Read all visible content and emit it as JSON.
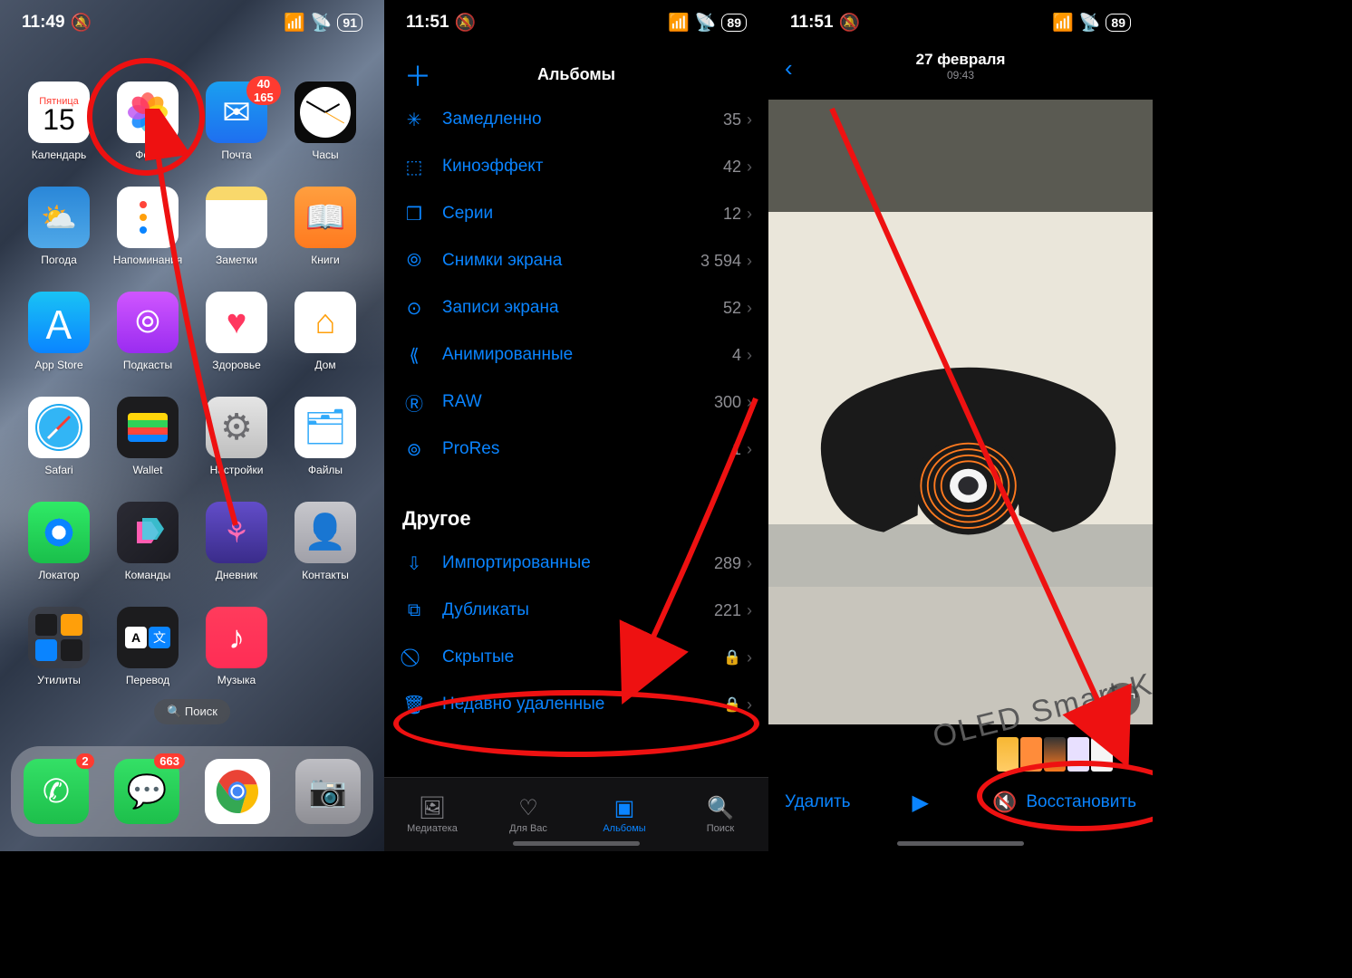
{
  "phone1": {
    "status": {
      "time": "11:49",
      "battery": "91"
    },
    "apps": [
      {
        "id": "calendar",
        "label": "Календарь",
        "day": "Пятница",
        "num": "15"
      },
      {
        "id": "photos",
        "label": "Фото"
      },
      {
        "id": "mail",
        "label": "Почта",
        "badge": "40 165"
      },
      {
        "id": "clock",
        "label": "Часы"
      },
      {
        "id": "weather",
        "label": "Погода"
      },
      {
        "id": "reminders",
        "label": "Напоминания"
      },
      {
        "id": "notes",
        "label": "Заметки"
      },
      {
        "id": "books",
        "label": "Книги"
      },
      {
        "id": "appstore",
        "label": "App Store"
      },
      {
        "id": "podcasts",
        "label": "Подкасты"
      },
      {
        "id": "health",
        "label": "Здоровье"
      },
      {
        "id": "home",
        "label": "Дом"
      },
      {
        "id": "safari",
        "label": "Safari"
      },
      {
        "id": "wallet",
        "label": "Wallet"
      },
      {
        "id": "settings",
        "label": "Настройки"
      },
      {
        "id": "files",
        "label": "Файлы"
      },
      {
        "id": "findmy",
        "label": "Локатор"
      },
      {
        "id": "shortcuts",
        "label": "Команды"
      },
      {
        "id": "journal",
        "label": "Дневник"
      },
      {
        "id": "contacts",
        "label": "Контакты"
      },
      {
        "id": "utilities",
        "label": "Утилиты"
      },
      {
        "id": "translate",
        "label": "Перевод"
      },
      {
        "id": "music",
        "label": "Музыка"
      }
    ],
    "dock": {
      "phone": {
        "badge": "2"
      },
      "messages": {
        "badge": "663"
      }
    },
    "search": "Поиск"
  },
  "phone2": {
    "status": {
      "time": "11:51",
      "battery": "89"
    },
    "headerTitle": "Альбомы",
    "mediaTypes": [
      {
        "icon": "slowmo-icon",
        "label": "Замедленно",
        "count": "35"
      },
      {
        "icon": "cinematic-icon",
        "label": "Киноэффект",
        "count": "42"
      },
      {
        "icon": "burst-icon",
        "label": "Серии",
        "count": "12"
      },
      {
        "icon": "screenshot-icon",
        "label": "Снимки экрана",
        "count": "3 594"
      },
      {
        "icon": "screenrec-icon",
        "label": "Записи экрана",
        "count": "52"
      },
      {
        "icon": "animated-icon",
        "label": "Анимированные",
        "count": "4"
      },
      {
        "icon": "raw-icon",
        "label": "RAW",
        "count": "300"
      },
      {
        "icon": "prores-icon",
        "label": "ProRes",
        "count": "1"
      }
    ],
    "otherHeader": "Другое",
    "other": [
      {
        "icon": "import-icon",
        "label": "Импортированные",
        "count": "289"
      },
      {
        "icon": "duplicate-icon",
        "label": "Дубликаты",
        "count": "221"
      },
      {
        "icon": "hidden-icon",
        "label": "Скрытые",
        "locked": true
      },
      {
        "icon": "trash-icon",
        "label": "Недавно удаленные",
        "locked": true
      }
    ],
    "tabs": [
      {
        "id": "library",
        "label": "Медиатека"
      },
      {
        "id": "foryou",
        "label": "Для Вас"
      },
      {
        "id": "albums",
        "label": "Альбомы",
        "active": true
      },
      {
        "id": "search",
        "label": "Поиск"
      }
    ]
  },
  "phone3": {
    "status": {
      "time": "11:51",
      "battery": "89"
    },
    "dateLine1": "27 февраля",
    "dateLine2": "09:43",
    "photoCaption": "OLED Smart Key",
    "actions": {
      "delete": "Удалить",
      "restore": "Восстановить"
    }
  },
  "iconGlyphs": {
    "slowmo-icon": "✳",
    "cinematic-icon": "⬚",
    "burst-icon": "❒",
    "screenshot-icon": "⦾",
    "screenrec-icon": "⊙",
    "animated-icon": "⟪",
    "raw-icon": "Ⓡ",
    "prores-icon": "⊚",
    "import-icon": "⇩",
    "duplicate-icon": "⧉",
    "hidden-icon": "⃠",
    "trash-icon": "🗑"
  }
}
